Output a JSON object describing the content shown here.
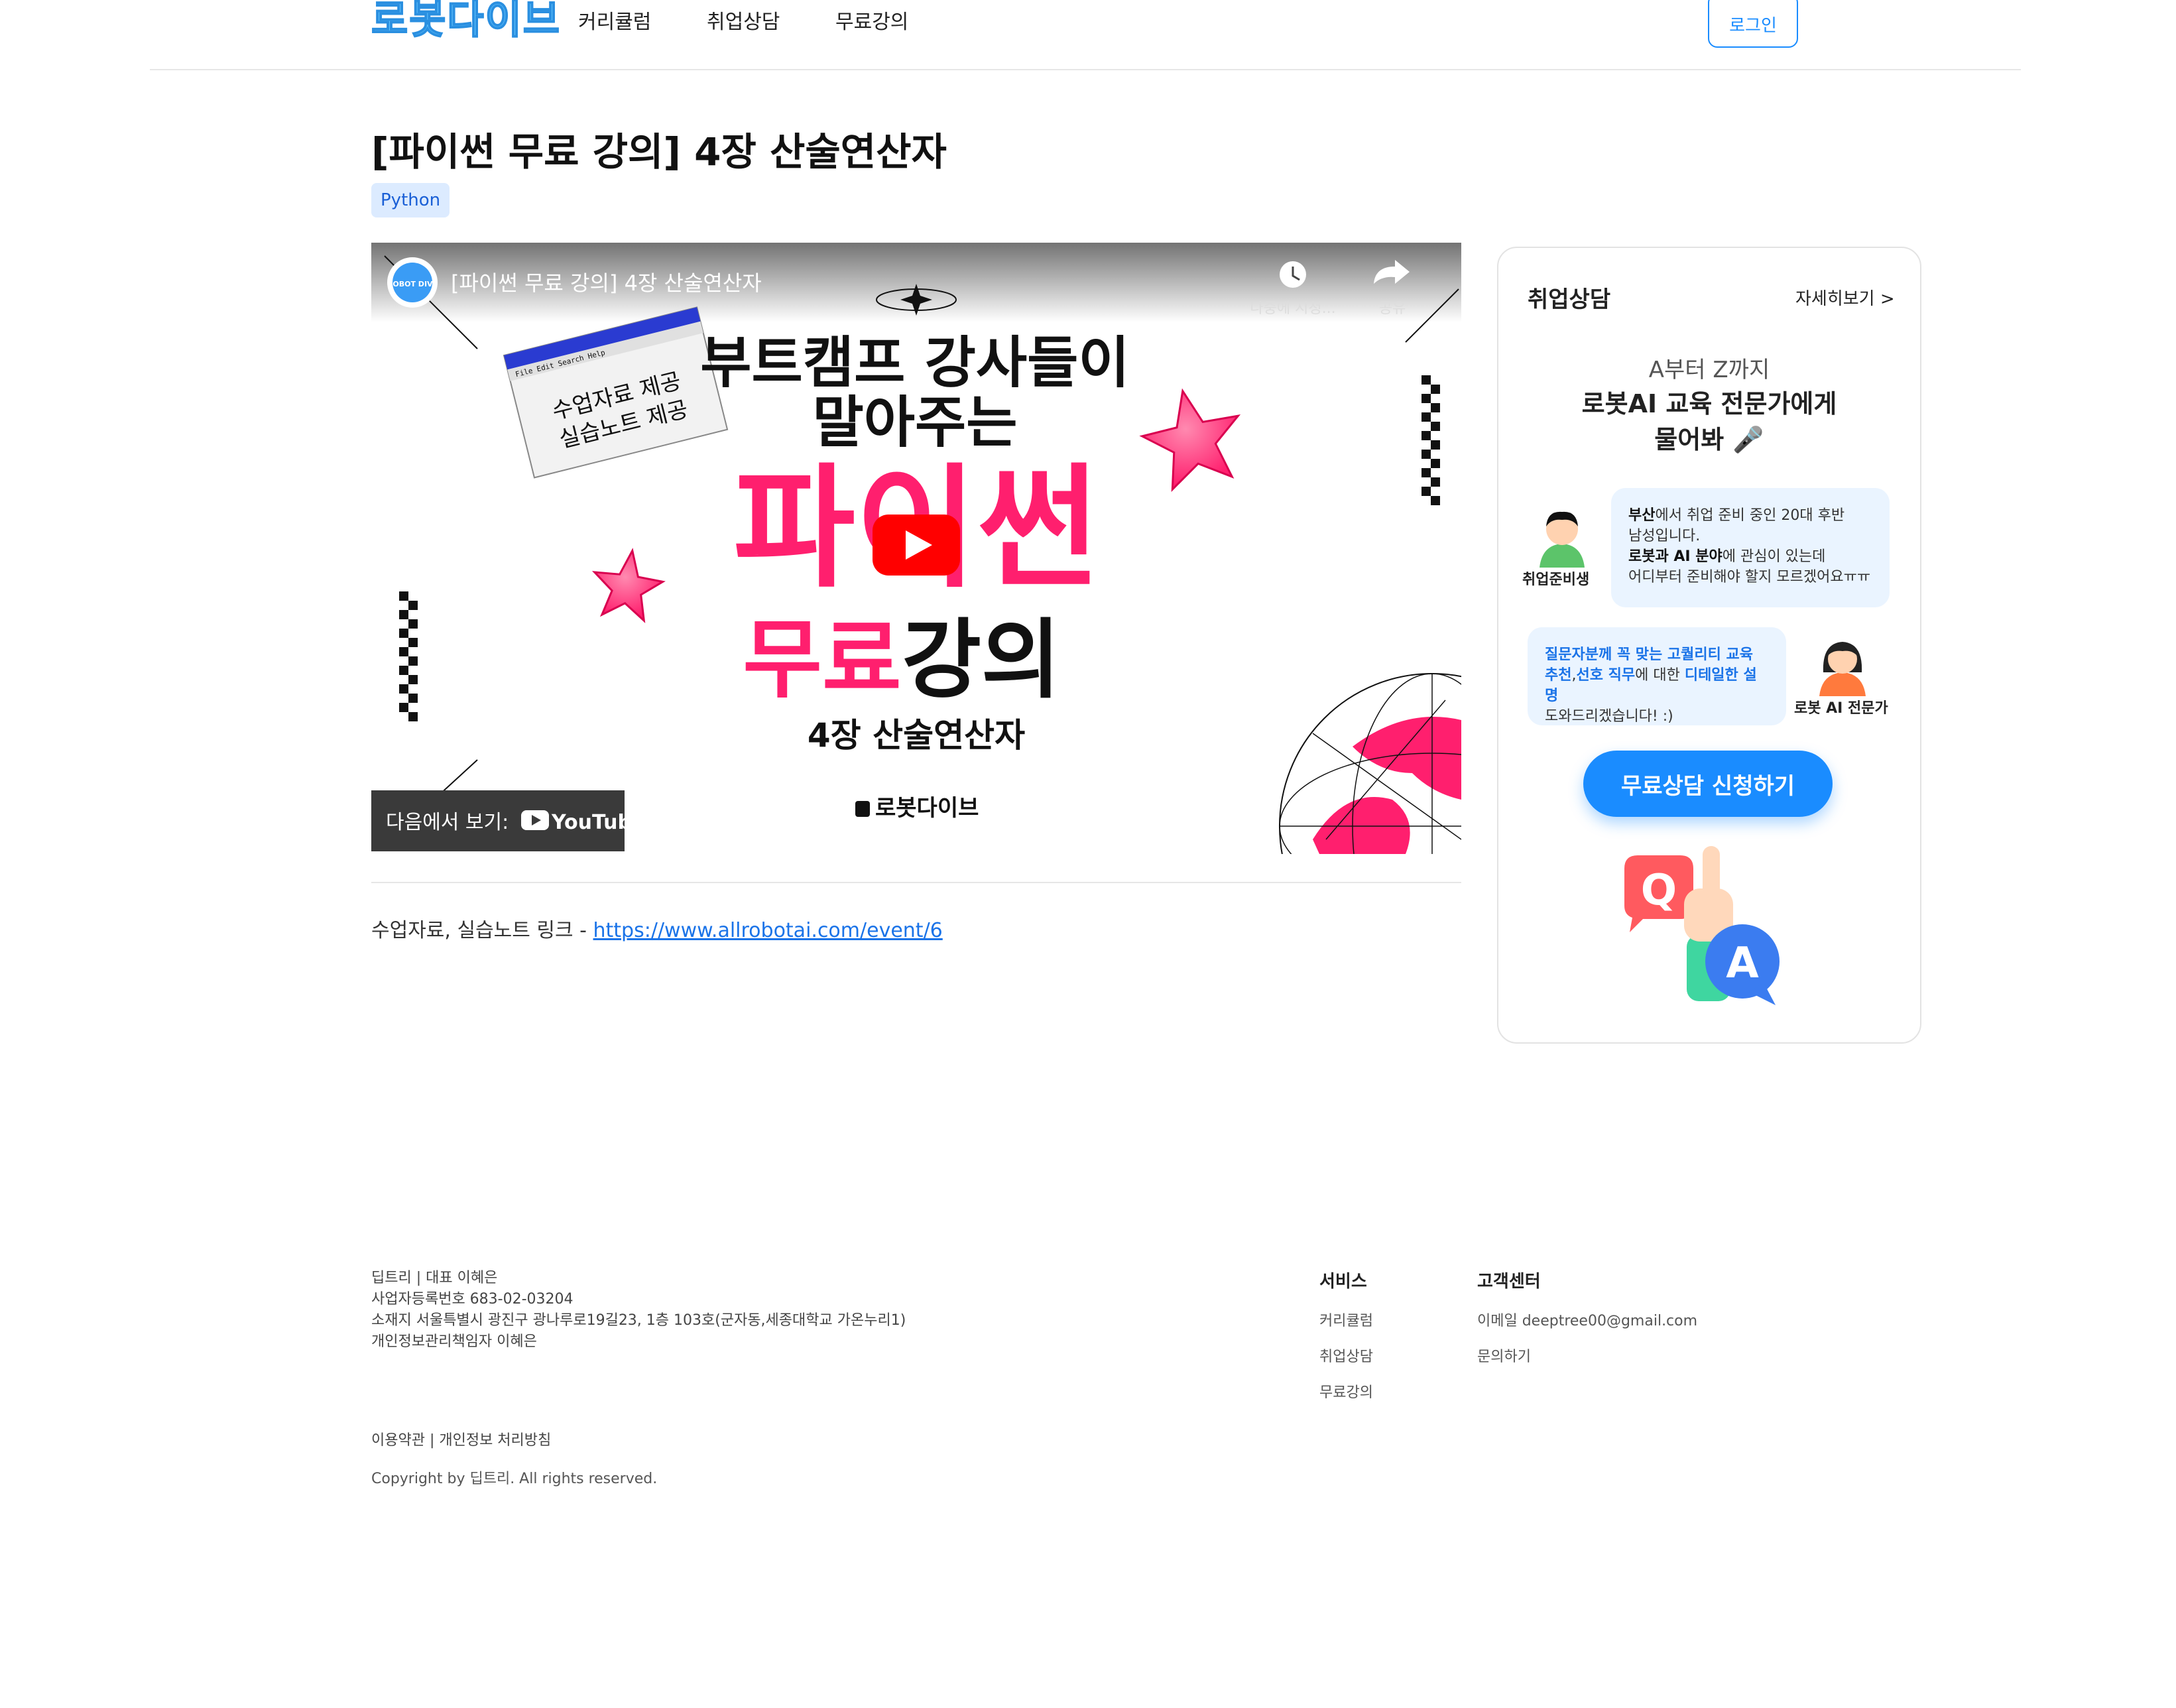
{
  "header": {
    "logo": "로봇다이브",
    "nav": [
      "커리큘럼",
      "취업상담",
      "무료강의"
    ],
    "login": "로그인"
  },
  "page": {
    "title": "[파이썬 무료 강의] 4장 산술연산자",
    "tag": "Python"
  },
  "video": {
    "title": "[파이썬 무료 강의] 4장 산술연산자",
    "watch_later": "나중에 시청...",
    "share": "공유",
    "headline1": "부트캠프 강사들이",
    "headline2": "말아주는",
    "big1": "파이썬",
    "big2a": "무료",
    "big2b": "강의",
    "chapter": "4장 산술연산자",
    "brand": "로봇다이브",
    "window_line1": "수업자료 제공",
    "window_line2": "실습노트 제공",
    "window_menu": "File  Edit  Search  Help",
    "watch_on": "다음에서 보기:",
    "youtube": "YouTube",
    "channel_badge": "ROBOT DIVE"
  },
  "description": {
    "text": "수업자료, 실습노트 링크 - ",
    "link": "https://www.allrobotai.com/event/6"
  },
  "consult": {
    "title": "취업상담",
    "more": "자세히보기 >",
    "sub": "A부터 Z까지",
    "head1": "로봇AI 교육 전문가에게",
    "head2": "물어봐 🎤",
    "student_label": "취업준비생",
    "q1_bold": "부산",
    "q1_rest": "에서 취업 준비 중인 20대 후반",
    "q2": "남성입니다.",
    "q3_bold": "로봇과 AI 분야",
    "q3_rest": "에 관심이 있는데",
    "q4": "어디부터 준비해야 할지 모르겠어요ㅠㅠ",
    "expert_label": "로봇 AI 전문가",
    "a1": "질문자분께 꼭 맞는 고퀄리티 교육",
    "a2_hl1": "추천",
    "a2_sep": ",",
    "a2_hl2": "선호 직무",
    "a2_mid": "에 대한 ",
    "a2_hl3": "디테일한 설명",
    "a3": "도와드리겠습니다! :)",
    "cta": "무료상담 신청하기",
    "qa_q": "Q",
    "qa_a": "A"
  },
  "footer": {
    "info": [
      "딥트리 | 대표 이혜은",
      "사업자등록번호 683-02-03204",
      "소재지 서울특별시 광진구 광나루로19길23, 1층 103호(군자동,세종대학교 가온누리1)",
      "개인정보관리책임자 이혜은"
    ],
    "services_title": "서비스",
    "services": [
      "커리큘럼",
      "취업상담",
      "무료강의"
    ],
    "support_title": "고객센터",
    "support": [
      "이메일 deeptree00@gmail.com",
      "문의하기"
    ],
    "legal": "이용약관 | 개인정보 처리방침",
    "copyright": "Copyright by 딥트리. All rights reserved."
  },
  "colors": {
    "accent": "#1a8cff",
    "pink": "#ff1f6e",
    "bubble": "#eaf4ff"
  }
}
